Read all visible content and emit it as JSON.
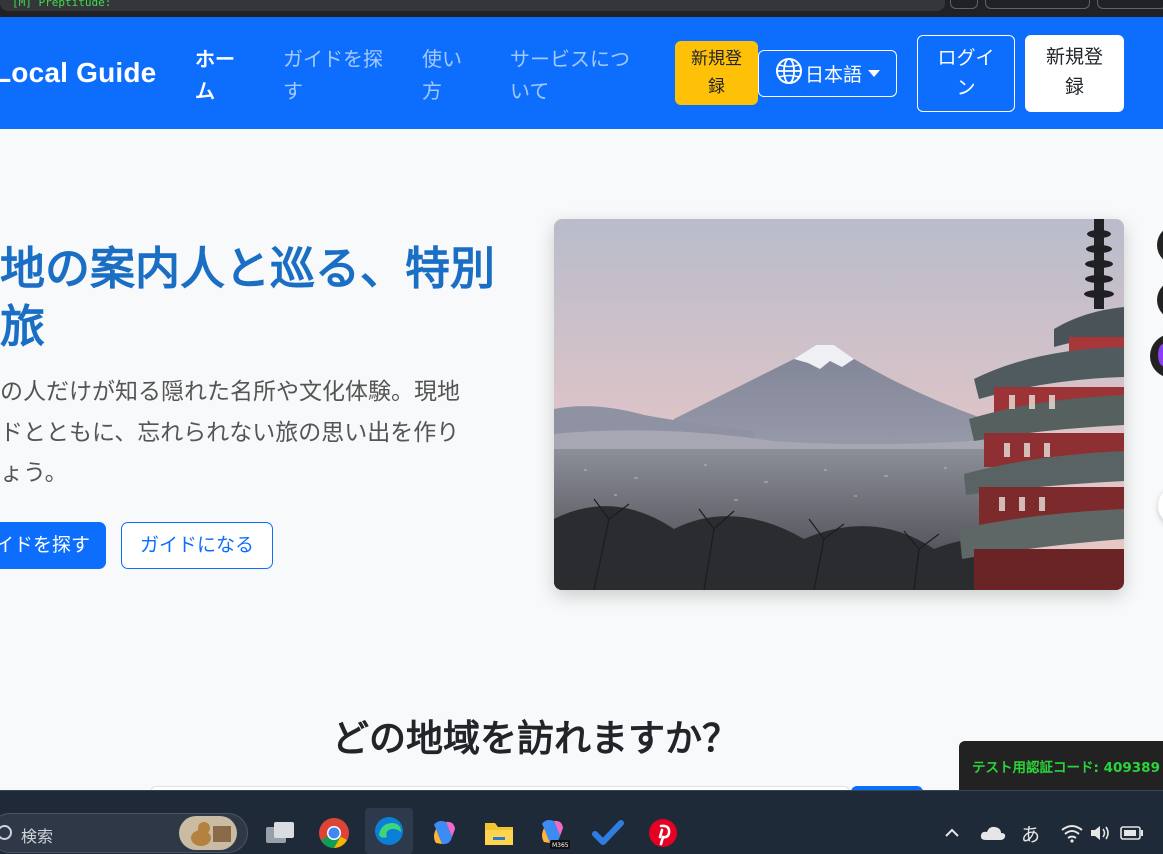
{
  "browser": {
    "tab_tag": "[M] Preptitude:"
  },
  "navbar": {
    "brand": "Local Guide",
    "links": [
      {
        "line1": "ホー",
        "line2": "ム",
        "active": true
      },
      {
        "line1": "ガイドを探",
        "line2": "す",
        "active": false
      },
      {
        "line1": "使い",
        "line2": "方",
        "active": false
      },
      {
        "line1": "サービスにつ",
        "line2": "いて",
        "active": false
      }
    ],
    "yellow_button": {
      "line1": "新規登",
      "line2": "録"
    },
    "language": "日本語",
    "login": {
      "line1": "ログイ",
      "line2": "ン"
    },
    "signup": {
      "line1": "新規登",
      "line2": "録"
    }
  },
  "hero": {
    "title_line1": "地の案内人と巡る、特別",
    "title_line2": "旅",
    "text_line1": "の人だけが知る隠れた名所や文化体験。現地",
    "text_line2": "ドとともに、忘れられない旅の思い出を作り",
    "text_line3": "ょう。",
    "find_button": "イドを探す",
    "become_button": "ガイドになる"
  },
  "section": {
    "region_title": "どの地域を訪れますか？"
  },
  "toast": {
    "label": "テスト用認証コード:",
    "code": "409389"
  },
  "taskbar": {
    "search_label": "検索",
    "ime": "あ"
  },
  "colors": {
    "primary": "#0d6efd",
    "warning": "#ffc107",
    "taskbar": "#1f2a38",
    "toast_text": "#2ad43a"
  }
}
